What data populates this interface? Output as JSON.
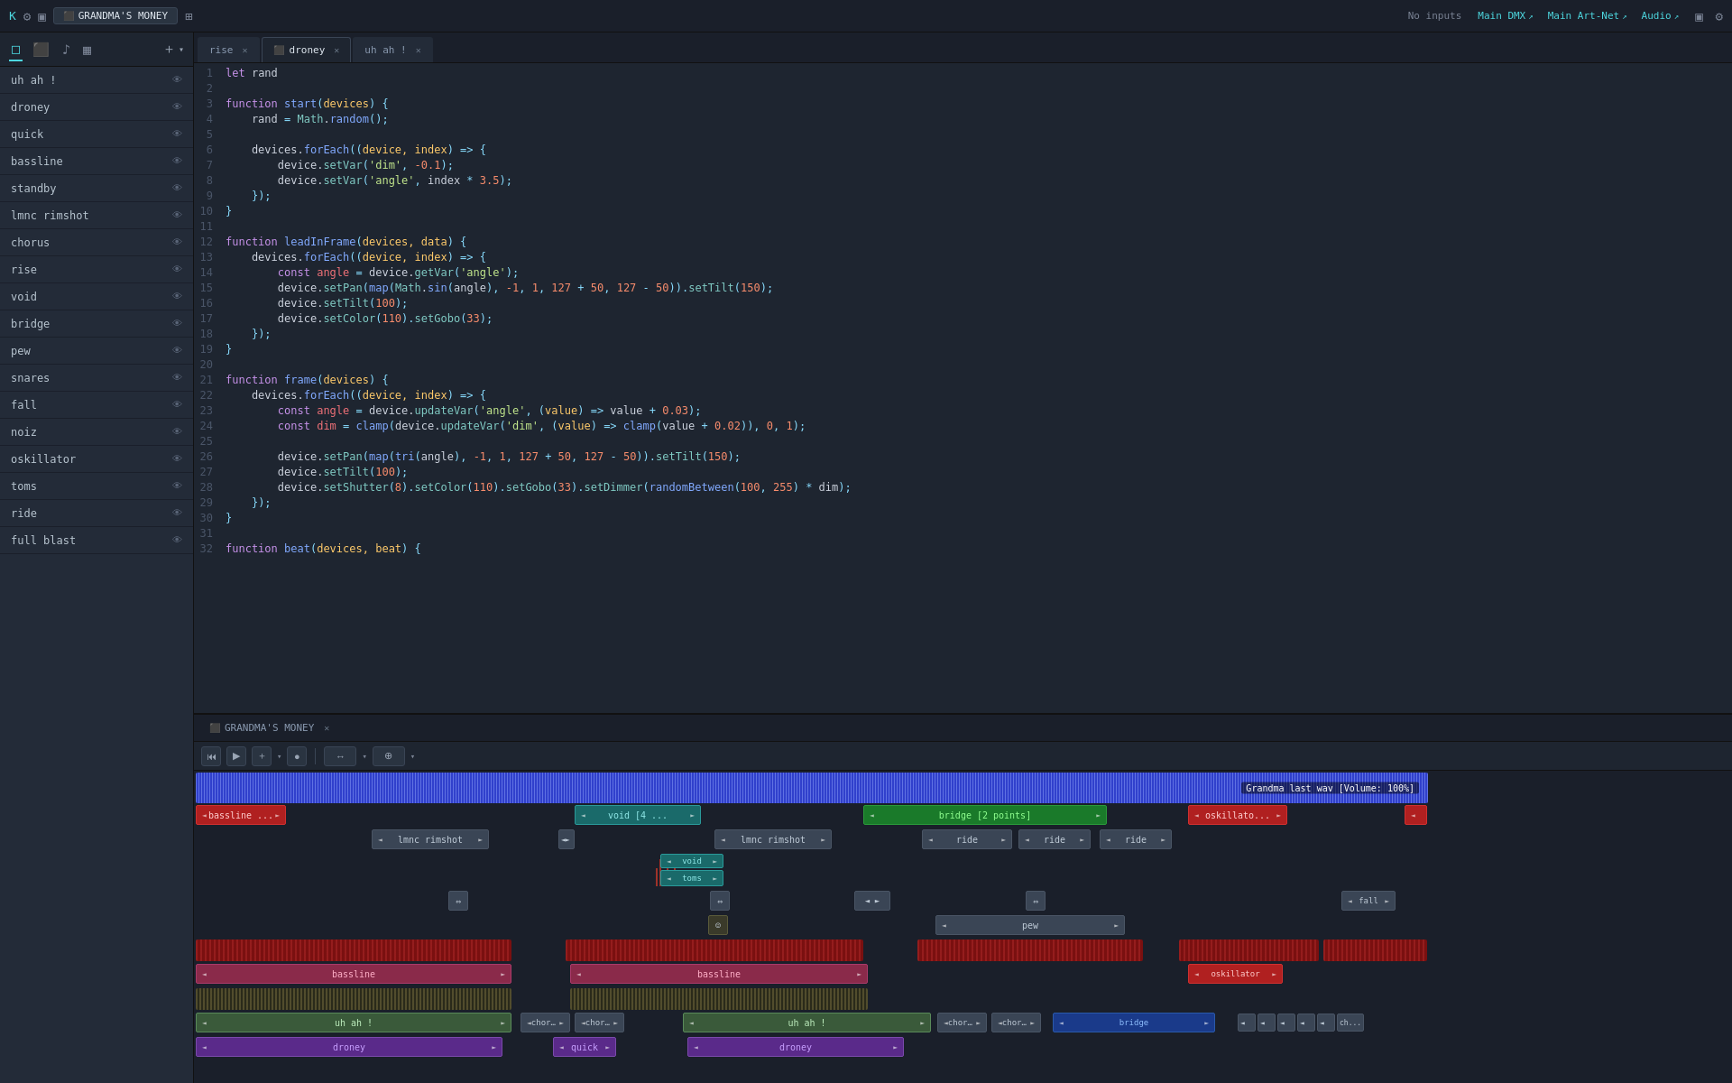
{
  "topbar": {
    "app_icon": "⊞",
    "gear_label": "⚙",
    "window_label": "▣",
    "grid_label": "⊞",
    "project_name": "GRANDMA'S MONEY",
    "no_inputs_label": "No inputs",
    "main_dmx_label": "Main DMX",
    "main_artnet_label": "Main Art-Net",
    "audio_label": "Audio",
    "monitor_label": "▣",
    "settings_label": "⚙"
  },
  "sidebar": {
    "tools": [
      "□",
      "⬛",
      "♪",
      "▦",
      "⊞"
    ],
    "items": [
      {
        "label": "uh ah !",
        "visible": true
      },
      {
        "label": "droney",
        "visible": true
      },
      {
        "label": "quick",
        "visible": true
      },
      {
        "label": "bassline",
        "visible": true
      },
      {
        "label": "standby",
        "visible": true
      },
      {
        "label": "lmnc rimshot",
        "visible": true
      },
      {
        "label": "chorus",
        "visible": true
      },
      {
        "label": "rise",
        "visible": true
      },
      {
        "label": "void",
        "visible": true
      },
      {
        "label": "bridge",
        "visible": true
      },
      {
        "label": "pew",
        "visible": true
      },
      {
        "label": "snares",
        "visible": true
      },
      {
        "label": "fall",
        "visible": true
      },
      {
        "label": "noiz",
        "visible": true
      },
      {
        "label": "oskillator",
        "visible": true
      },
      {
        "label": "toms",
        "visible": true
      },
      {
        "label": "ride",
        "visible": true
      },
      {
        "label": "full blast",
        "visible": true
      }
    ]
  },
  "editor": {
    "tabs": [
      {
        "label": "rise",
        "active": false,
        "closeable": true
      },
      {
        "label": "droney",
        "active": true,
        "closeable": true
      },
      {
        "label": "uh ah !",
        "active": false,
        "closeable": true
      }
    ],
    "code_lines": [
      {
        "num": 1,
        "text": "let rand"
      },
      {
        "num": 2,
        "text": ""
      },
      {
        "num": 3,
        "text": "function start(devices) {"
      },
      {
        "num": 4,
        "text": "  rand = Math.random();"
      },
      {
        "num": 5,
        "text": ""
      },
      {
        "num": 6,
        "text": "  devices.forEach((device, index) => {"
      },
      {
        "num": 7,
        "text": "    device.setVar('dim', -0.1);"
      },
      {
        "num": 8,
        "text": "    device.setVar('angle', index * 3.5);"
      },
      {
        "num": 9,
        "text": "  });"
      },
      {
        "num": 10,
        "text": "}"
      },
      {
        "num": 11,
        "text": ""
      },
      {
        "num": 12,
        "text": "function leadInFrame(devices, data) {"
      },
      {
        "num": 13,
        "text": "  devices.forEach((device, index) => {"
      },
      {
        "num": 14,
        "text": "    const angle = device.getVar('angle');"
      },
      {
        "num": 15,
        "text": "    device.setPan(map(Math.sin(angle), -1, 1, 127 + 50, 127 - 50)).setTilt(150);"
      },
      {
        "num": 16,
        "text": "    device.setTilt(100);"
      },
      {
        "num": 17,
        "text": "    device.setColor(110).setGobo(33);"
      },
      {
        "num": 18,
        "text": "  });"
      },
      {
        "num": 19,
        "text": "}"
      },
      {
        "num": 20,
        "text": ""
      },
      {
        "num": 21,
        "text": "function frame(devices) {"
      },
      {
        "num": 22,
        "text": "  devices.forEach((device, index) => {"
      },
      {
        "num": 23,
        "text": "    const angle = device.updateVar('angle', (value) => value + 0.03);"
      },
      {
        "num": 24,
        "text": "    const dim = clamp(device.updateVar('dim', (value) => clamp(value + 0.02)), 0, 1);"
      },
      {
        "num": 25,
        "text": ""
      },
      {
        "num": 26,
        "text": "    device.setPan(map(tri(angle), -1, 1, 127 + 50, 127 - 50)).setTilt(150);"
      },
      {
        "num": 27,
        "text": "    device.setTilt(100);"
      },
      {
        "num": 28,
        "text": "    device.setShutter(8).setColor(110).setGobo(33).setDimmer(randomBetween(100, 255) * dim);"
      },
      {
        "num": 29,
        "text": "  });"
      },
      {
        "num": 30,
        "text": "}"
      },
      {
        "num": 31,
        "text": ""
      },
      {
        "num": 32,
        "text": "function beat(devices, beat) {"
      }
    ]
  },
  "timeline": {
    "tab_label": "GRANDMA'S MONEY",
    "toolbar_buttons": [
      "⏮",
      "▶",
      "+",
      "●",
      "↔",
      "⊕"
    ],
    "waveform_label": "Grandma last wav [Volume: 100%]"
  }
}
